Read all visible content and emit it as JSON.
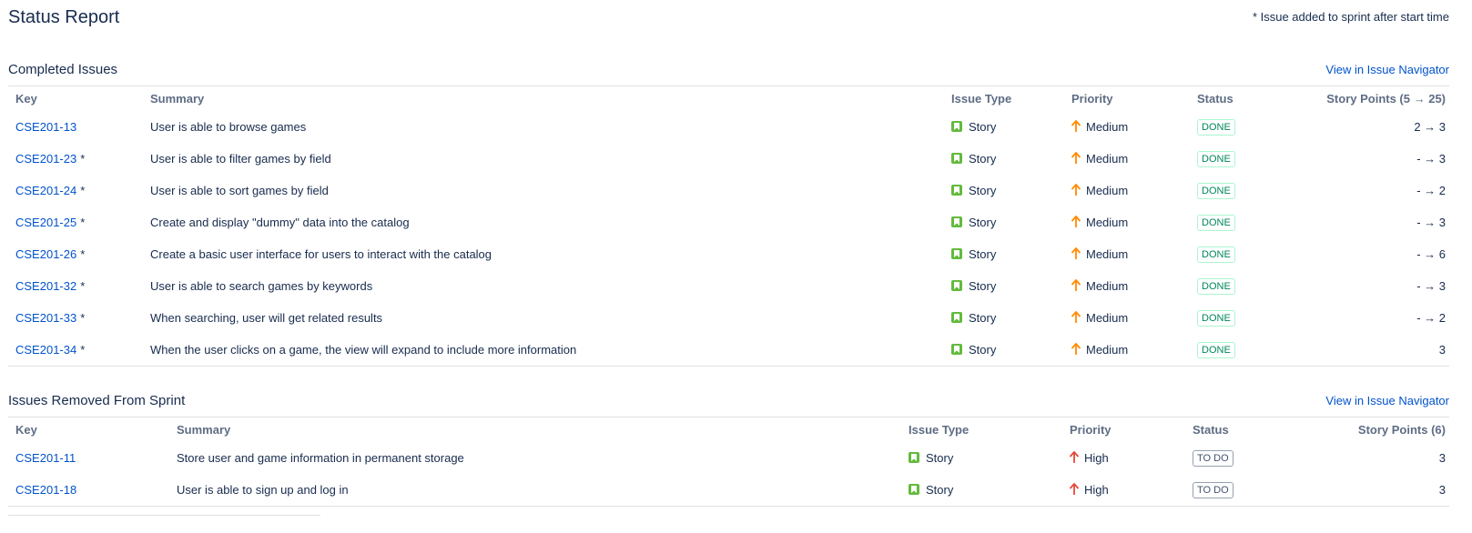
{
  "header": {
    "title": "Status Report",
    "note": "* Issue added to sprint after start time"
  },
  "colors": {
    "link": "#0052cc",
    "story_icon": "#63ba3c",
    "priority_medium": "#ff8b00",
    "priority_high": "#e5493a",
    "done": "#00875a"
  },
  "completed": {
    "title": "Completed Issues",
    "nav_link": "View in Issue Navigator",
    "columns": {
      "key": "Key",
      "summary": "Summary",
      "type": "Issue Type",
      "priority": "Priority",
      "status": "Status",
      "points": "Story Points (5 → 25)"
    },
    "rows": [
      {
        "key": "CSE201-13",
        "added": "",
        "summary": "User is able to browse games",
        "type": "Story",
        "priority": "Medium",
        "status": "DONE",
        "points": "2 → 3"
      },
      {
        "key": "CSE201-23",
        "added": "*",
        "summary": "User is able to filter games by field",
        "type": "Story",
        "priority": "Medium",
        "status": "DONE",
        "points": "- → 3"
      },
      {
        "key": "CSE201-24",
        "added": "*",
        "summary": "User is able to sort games by field",
        "type": "Story",
        "priority": "Medium",
        "status": "DONE",
        "points": "- → 2"
      },
      {
        "key": "CSE201-25",
        "added": "*",
        "summary": "Create and display \"dummy\" data into the catalog",
        "type": "Story",
        "priority": "Medium",
        "status": "DONE",
        "points": "- → 3"
      },
      {
        "key": "CSE201-26",
        "added": "*",
        "summary": "Create a basic user interface for users to interact with the catalog",
        "type": "Story",
        "priority": "Medium",
        "status": "DONE",
        "points": "- → 6"
      },
      {
        "key": "CSE201-32",
        "added": "*",
        "summary": "User is able to search games by keywords",
        "type": "Story",
        "priority": "Medium",
        "status": "DONE",
        "points": "- → 3"
      },
      {
        "key": "CSE201-33",
        "added": "*",
        "summary": "When searching, user will get related results",
        "type": "Story",
        "priority": "Medium",
        "status": "DONE",
        "points": "- → 2"
      },
      {
        "key": "CSE201-34",
        "added": "*",
        "summary": "When the user clicks on a game, the view will expand to include more information",
        "type": "Story",
        "priority": "Medium",
        "status": "DONE",
        "points": "3"
      }
    ]
  },
  "removed": {
    "title": "Issues Removed From Sprint",
    "nav_link": "View in Issue Navigator",
    "columns": {
      "key": "Key",
      "summary": "Summary",
      "type": "Issue Type",
      "priority": "Priority",
      "status": "Status",
      "points": "Story Points (6)"
    },
    "rows": [
      {
        "key": "CSE201-11",
        "added": "",
        "summary": "Store user and game information in permanent storage",
        "type": "Story",
        "priority": "High",
        "status": "TO DO",
        "points": "3"
      },
      {
        "key": "CSE201-18",
        "added": "",
        "summary": "User is able to sign up and log in",
        "type": "Story",
        "priority": "High",
        "status": "TO DO",
        "points": "3"
      }
    ]
  }
}
